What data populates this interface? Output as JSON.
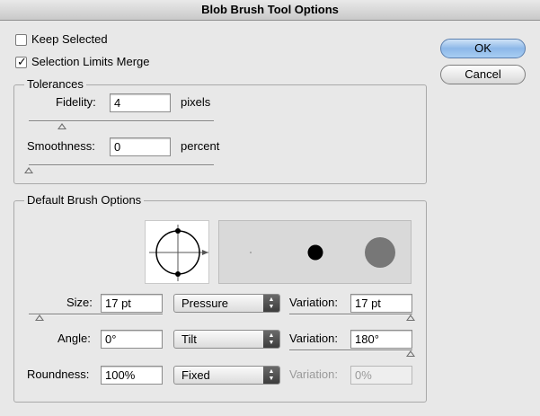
{
  "window": {
    "title": "Blob Brush Tool Options"
  },
  "checkboxes": {
    "keep_selected": {
      "label": "Keep Selected",
      "checked": false
    },
    "selection_limits_merge": {
      "label": "Selection Limits Merge",
      "checked": true
    }
  },
  "buttons": {
    "ok": "OK",
    "cancel": "Cancel"
  },
  "tolerances": {
    "title": "Tolerances",
    "fidelity": {
      "label": "Fidelity:",
      "value": "4",
      "unit": "pixels"
    },
    "smoothness": {
      "label": "Smoothness:",
      "value": "0",
      "unit": "percent"
    }
  },
  "brush": {
    "title": "Default Brush Options",
    "size": {
      "label": "Size:",
      "value": "17 pt",
      "mode": "Pressure",
      "variation_label": "Variation:",
      "variation": "17 pt"
    },
    "angle": {
      "label": "Angle:",
      "value": "0°",
      "mode": "Tilt",
      "variation_label": "Variation:",
      "variation": "180°"
    },
    "roundness": {
      "label": "Roundness:",
      "value": "100%",
      "mode": "Fixed",
      "variation_label": "Variation:",
      "variation": "0%"
    }
  },
  "icons": {
    "checkmark": "checkmark-icon",
    "select_arrows": "updown-arrows-icon",
    "brush_shape": "brush-shape-preview-icon",
    "slider_thumb": "triangle-up-icon"
  },
  "colors": {
    "background": "#e8e8e8",
    "default_button": "#8db8e8",
    "preview_dot_small": "#000000",
    "preview_dot_large": "#777777"
  }
}
